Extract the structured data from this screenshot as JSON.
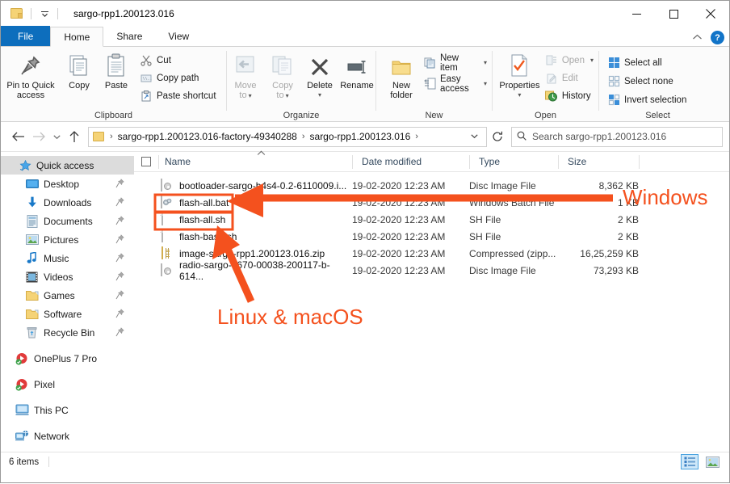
{
  "window": {
    "title": "sargo-rpp1.200123.016",
    "folder_icon": "folder-icon",
    "quick_access_toolbar_caret": "chevron-down-icon",
    "controls": {
      "minimize": "minimize-icon",
      "maximize": "maximize-icon",
      "close": "close-icon"
    }
  },
  "ribbon": {
    "tabs": [
      {
        "label": "File",
        "state": "file"
      },
      {
        "label": "Home",
        "state": "active"
      },
      {
        "label": "Share",
        "state": "normal"
      },
      {
        "label": "View",
        "state": "normal"
      }
    ],
    "collapse_icon": "chevron-up-icon",
    "help_label": "?",
    "groups": [
      {
        "name": "Clipboard",
        "label": "Clipboard",
        "big_buttons": [
          {
            "label": "Pin to Quick\naccess",
            "line1": "Pin to Quick",
            "line2": "access",
            "icon": "pin-icon",
            "disabled": false
          },
          {
            "label": "Copy",
            "line1": "Copy",
            "line2": "",
            "icon": "copy-icon",
            "disabled": false
          },
          {
            "label": "Paste",
            "line1": "Paste",
            "line2": "",
            "icon": "paste-icon",
            "disabled": false
          }
        ],
        "small_buttons": [
          {
            "label": "Cut",
            "icon": "scissors-icon",
            "disabled": false
          },
          {
            "label": "Copy path",
            "icon": "copy-path-icon",
            "disabled": false
          },
          {
            "label": "Paste shortcut",
            "icon": "paste-shortcut-icon",
            "disabled": false
          }
        ]
      },
      {
        "name": "Organize",
        "label": "Organize",
        "big_buttons": [
          {
            "line1": "Move",
            "line2": "to",
            "icon": "move-to-icon",
            "disabled": true,
            "caret": true
          },
          {
            "line1": "Copy",
            "line2": "to",
            "icon": "copy-to-icon",
            "disabled": true,
            "caret": true
          },
          {
            "line1": "Delete",
            "line2": "",
            "icon": "delete-icon",
            "disabled": false,
            "caret_below": true
          },
          {
            "line1": "Rename",
            "line2": "",
            "icon": "rename-icon",
            "disabled": false
          }
        ]
      },
      {
        "name": "New",
        "label": "New",
        "big_buttons": [
          {
            "line1": "New",
            "line2": "folder",
            "icon": "new-folder-icon",
            "disabled": false
          }
        ],
        "small_buttons": [
          {
            "label": "New item",
            "icon": "new-item-icon",
            "disabled": false,
            "caret": true
          },
          {
            "label": "Easy access",
            "icon": "easy-access-icon",
            "disabled": false,
            "caret": true
          }
        ]
      },
      {
        "name": "Open",
        "label": "Open",
        "big_buttons": [
          {
            "line1": "Properties",
            "line2": "",
            "icon": "properties-icon",
            "disabled": false,
            "caret_below": true
          }
        ],
        "small_buttons": [
          {
            "label": "Open",
            "icon": "open-icon",
            "disabled": true,
            "caret": true
          },
          {
            "label": "Edit",
            "icon": "edit-icon",
            "disabled": true
          },
          {
            "label": "History",
            "icon": "history-icon",
            "disabled": false
          }
        ]
      },
      {
        "name": "Select",
        "label": "Select",
        "small_buttons": [
          {
            "label": "Select all",
            "icon": "select-all-icon",
            "disabled": false
          },
          {
            "label": "Select none",
            "icon": "select-none-icon",
            "disabled": false
          },
          {
            "label": "Invert selection",
            "icon": "invert-selection-icon",
            "disabled": false
          }
        ]
      }
    ]
  },
  "navigation": {
    "back_icon": "arrow-left-icon",
    "forward_icon": "arrow-right-icon",
    "recent_icon": "chevron-down-icon",
    "up_icon": "arrow-up-icon",
    "breadcrumbs": [
      "sargo-rpp1.200123.016-factory-49340288",
      "sargo-rpp1.200123.016"
    ],
    "dropdown_icon": "chevron-down-icon",
    "refresh_icon": "refresh-icon"
  },
  "search": {
    "icon": "search-icon",
    "placeholder": "Search sargo-rpp1.200123.016",
    "value": ""
  },
  "sidebar": {
    "items": [
      {
        "label": "Quick access",
        "icon": "quick-access-star-icon",
        "selected": true,
        "pinned": false,
        "level": 0
      },
      {
        "label": "Desktop",
        "icon": "desktop-icon",
        "selected": false,
        "pinned": true,
        "level": 1
      },
      {
        "label": "Downloads",
        "icon": "downloads-icon",
        "selected": false,
        "pinned": true,
        "level": 1
      },
      {
        "label": "Documents",
        "icon": "documents-icon",
        "selected": false,
        "pinned": true,
        "level": 1
      },
      {
        "label": "Pictures",
        "icon": "pictures-icon",
        "selected": false,
        "pinned": true,
        "level": 1
      },
      {
        "label": "Music",
        "icon": "music-icon",
        "selected": false,
        "pinned": true,
        "level": 1
      },
      {
        "label": "Videos",
        "icon": "videos-icon",
        "selected": false,
        "pinned": true,
        "level": 1
      },
      {
        "label": "Games",
        "icon": "folder-icon",
        "selected": false,
        "pinned": true,
        "level": 1
      },
      {
        "label": "Software",
        "icon": "folder-icon",
        "selected": false,
        "pinned": true,
        "level": 1
      },
      {
        "label": "Recycle Bin",
        "icon": "recycle-bin-icon",
        "selected": false,
        "pinned": true,
        "level": 1
      }
    ],
    "roots": [
      {
        "label": "OnePlus 7 Pro",
        "icon": "phone-device-icon"
      },
      {
        "label": "Pixel",
        "icon": "phone-device-icon"
      },
      {
        "label": "This PC",
        "icon": "this-pc-icon"
      },
      {
        "label": "Network",
        "icon": "network-icon"
      }
    ]
  },
  "filelist": {
    "select_all_checkbox": false,
    "columns": [
      {
        "label": "Name",
        "sorted": true,
        "sort_dir": "asc"
      },
      {
        "label": "Date modified",
        "sorted": false
      },
      {
        "label": "Type",
        "sorted": false
      },
      {
        "label": "Size",
        "sorted": false
      }
    ],
    "rows": [
      {
        "name": "bootloader-sargo-b4s4-0.2-6110009.i...",
        "date": "19-02-2020 12:23 AM",
        "type": "Disc Image File",
        "size": "8,362 KB",
        "icon": "disc-image-file-icon",
        "highlighted": false
      },
      {
        "name": "flash-all.bat",
        "date": "19-02-2020 12:23 AM",
        "type": "Windows Batch File",
        "size": "1 KB",
        "icon": "batch-file-icon",
        "highlighted": true
      },
      {
        "name": "flash-all.sh",
        "date": "19-02-2020 12:23 AM",
        "type": "SH File",
        "size": "2 KB",
        "icon": "generic-file-icon",
        "highlighted": true
      },
      {
        "name": "flash-base.sh",
        "date": "19-02-2020 12:23 AM",
        "type": "SH File",
        "size": "2 KB",
        "icon": "generic-file-icon",
        "highlighted": false
      },
      {
        "name": "image-sargo-rpp1.200123.016.zip",
        "date": "19-02-2020 12:23 AM",
        "type": "Compressed (zipp...",
        "size": "16,25,259 KB",
        "icon": "zip-file-icon",
        "highlighted": false
      },
      {
        "name": "radio-sargo-q670-00038-200117-b-614...",
        "date": "19-02-2020 12:23 AM",
        "type": "Disc Image File",
        "size": "73,293 KB",
        "icon": "disc-image-file-icon",
        "highlighted": false
      }
    ]
  },
  "statusbar": {
    "item_count": "6 items",
    "views": [
      {
        "name": "details-view",
        "label": "Details view",
        "active": true
      },
      {
        "name": "large-icons-view",
        "label": "Large icons view",
        "active": false
      }
    ]
  },
  "annotations": {
    "accent_color": "#f4511e",
    "windows_label": "Windows",
    "linux_mac_label": "Linux & macOS"
  }
}
